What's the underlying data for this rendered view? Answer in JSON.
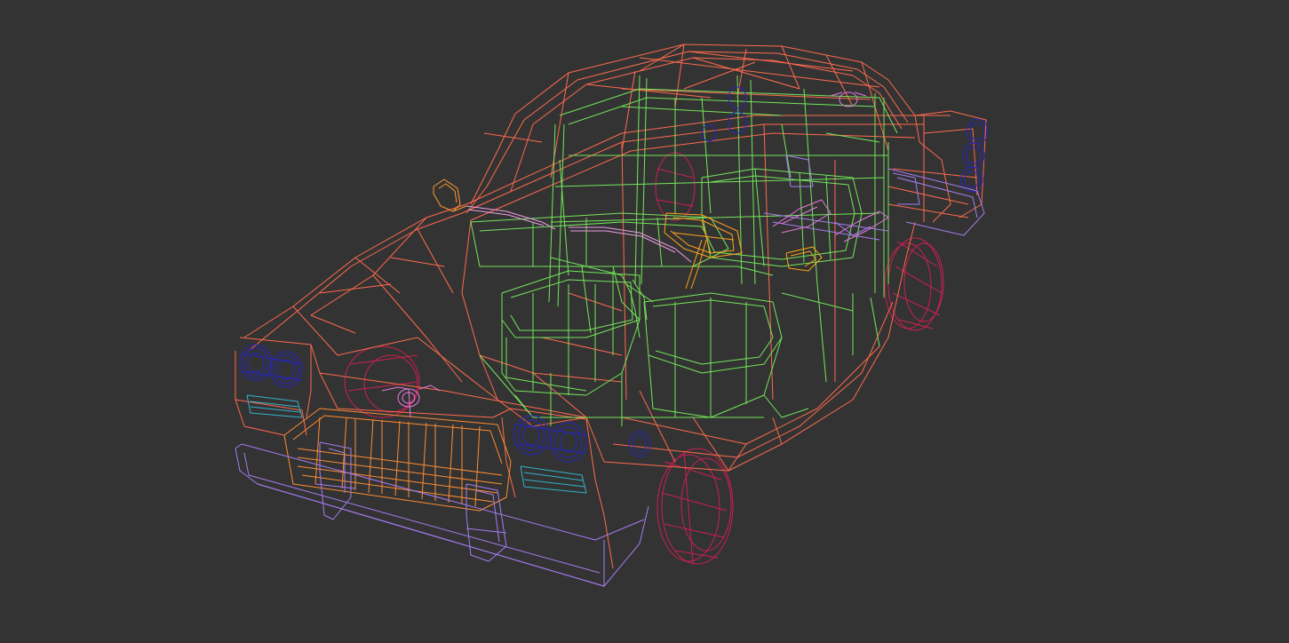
{
  "viewport": {
    "background": "#333333",
    "mode": "wireframe",
    "model": "car"
  },
  "colors": {
    "body": "#ff6a4d",
    "cabin": "#73e65a",
    "wheels": "#cc1f52",
    "bumpers": "#a67cf2",
    "grille": "#ff8c33",
    "headlights": "#2626c4",
    "signal_lights": "#33b3cc",
    "steering_wheel": "#ffa31a",
    "wipers": "#f09ee6",
    "badges": "#e67ae0",
    "mirror": "#ff9933"
  },
  "parts": [
    {
      "id": "body",
      "color_key": "body"
    },
    {
      "id": "cabin",
      "color_key": "cabin"
    },
    {
      "id": "wheels",
      "color_key": "wheels"
    },
    {
      "id": "bumpers",
      "color_key": "bumpers"
    },
    {
      "id": "grille",
      "color_key": "grille"
    },
    {
      "id": "headlights",
      "color_key": "headlights"
    },
    {
      "id": "signal_lights",
      "color_key": "signal_lights"
    },
    {
      "id": "steering_wheel",
      "color_key": "steering_wheel"
    },
    {
      "id": "wipers",
      "color_key": "wipers"
    },
    {
      "id": "badges",
      "color_key": "badges"
    },
    {
      "id": "mirror",
      "color_key": "mirror"
    }
  ]
}
